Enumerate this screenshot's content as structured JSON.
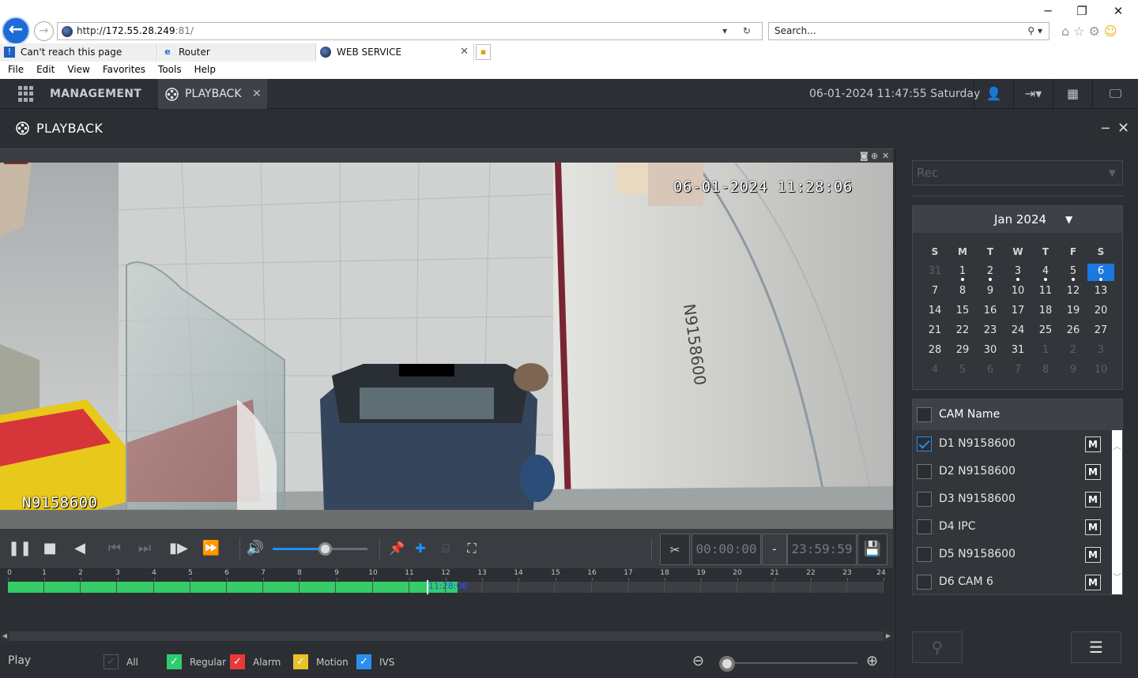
{
  "browser": {
    "window_controls": [
      "─",
      "❐",
      "✕"
    ],
    "address": {
      "url_prefix": "http://",
      "url_host": "172.55.28.249",
      "url_port": ":81/",
      "tools": "▾ ↻"
    },
    "search": {
      "placeholder": "Search...",
      "icon": "⚲ ▾"
    },
    "tabs": [
      {
        "label": "Can't reach this page",
        "icon": "error-page-icon"
      },
      {
        "label": "Router",
        "icon": "ie-icon"
      },
      {
        "label": "WEB SERVICE",
        "icon": "globe-icon",
        "close": "✕"
      }
    ],
    "menu": [
      "File",
      "Edit",
      "View",
      "Favorites",
      "Tools",
      "Help"
    ]
  },
  "nav": {
    "management": "MANAGEMENT",
    "playback_tab": "PLAYBACK",
    "playback_close": "✕",
    "datetime": "06-01-2024 11:47:55 Saturday",
    "icons": [
      "user-icon",
      "logout-icon",
      "qr-icon",
      "monitor-icon"
    ]
  },
  "subheader": {
    "title": "PLAYBACK",
    "min": "─",
    "close": "✕"
  },
  "video": {
    "osd_time": "06-01-2024 11:28:06",
    "osd_name": "N9158600",
    "scene_text": "N9158600"
  },
  "controls": {
    "volume_percent": 55,
    "clip_start": "00:00:00",
    "clip_dash": "-",
    "clip_end": "23:59:59"
  },
  "timeline": {
    "hours": [
      "0",
      "1",
      "2",
      "3",
      "4",
      "5",
      "6",
      "7",
      "8",
      "9",
      "10",
      "11",
      "12",
      "13",
      "14",
      "15",
      "16",
      "17",
      "18",
      "19",
      "20",
      "21",
      "22",
      "23",
      "24"
    ],
    "recorded_until_hour": 11.5,
    "cursor_hour": 11.47,
    "cursor_label": "11:28:06"
  },
  "legend": {
    "play_label": "Play",
    "items": [
      {
        "label": "All",
        "color": "#2b2e33",
        "checked": false
      },
      {
        "label": "Regular",
        "color": "#2ecc71",
        "checked": true
      },
      {
        "label": "Alarm",
        "color": "#e83a3a",
        "checked": true
      },
      {
        "label": "Motion",
        "color": "#e8c22a",
        "checked": true
      },
      {
        "label": "IVS",
        "color": "#2b8ef0",
        "checked": true
      }
    ],
    "zoom_out": "⊖",
    "zoom_in": "⊕"
  },
  "sidebar": {
    "record_type": "Rec",
    "calendar": {
      "month_label": "Jan 2024",
      "dow": [
        "S",
        "M",
        "T",
        "W",
        "T",
        "F",
        "S"
      ],
      "weeks": [
        [
          {
            "d": "31",
            "dim": true
          },
          {
            "d": "1",
            "rec": true
          },
          {
            "d": "2",
            "rec": true
          },
          {
            "d": "3",
            "rec": true
          },
          {
            "d": "4",
            "rec": true
          },
          {
            "d": "5",
            "rec": true
          },
          {
            "d": "6",
            "rec": true,
            "sel": true
          }
        ],
        [
          {
            "d": "7"
          },
          {
            "d": "8"
          },
          {
            "d": "9"
          },
          {
            "d": "10"
          },
          {
            "d": "11"
          },
          {
            "d": "12"
          },
          {
            "d": "13"
          }
        ],
        [
          {
            "d": "14"
          },
          {
            "d": "15"
          },
          {
            "d": "16"
          },
          {
            "d": "17"
          },
          {
            "d": "18"
          },
          {
            "d": "19"
          },
          {
            "d": "20"
          }
        ],
        [
          {
            "d": "21"
          },
          {
            "d": "22"
          },
          {
            "d": "23"
          },
          {
            "d": "24"
          },
          {
            "d": "25"
          },
          {
            "d": "26"
          },
          {
            "d": "27"
          }
        ],
        [
          {
            "d": "28"
          },
          {
            "d": "29"
          },
          {
            "d": "30"
          },
          {
            "d": "31"
          },
          {
            "d": "1",
            "dim": true
          },
          {
            "d": "2",
            "dim": true
          },
          {
            "d": "3",
            "dim": true
          }
        ],
        [
          {
            "d": "4",
            "dim": true
          },
          {
            "d": "5",
            "dim": true
          },
          {
            "d": "6",
            "dim": true
          },
          {
            "d": "7",
            "dim": true
          },
          {
            "d": "8",
            "dim": true
          },
          {
            "d": "9",
            "dim": true
          },
          {
            "d": "10",
            "dim": true
          }
        ]
      ]
    },
    "cam_header": "CAM Name",
    "cams": [
      {
        "name": "D1 N9158600",
        "checked": true
      },
      {
        "name": "D2 N9158600",
        "checked": false
      },
      {
        "name": "D3 N9158600",
        "checked": false
      },
      {
        "name": "D4 IPC",
        "checked": false
      },
      {
        "name": "D5 N9158600",
        "checked": false
      },
      {
        "name": "D6 CAM 6",
        "checked": false
      }
    ],
    "cam_m_label": "M"
  },
  "colors": {
    "accent": "#1b78e0",
    "record_green": "#33cc66",
    "panel": "#2b2e33"
  }
}
